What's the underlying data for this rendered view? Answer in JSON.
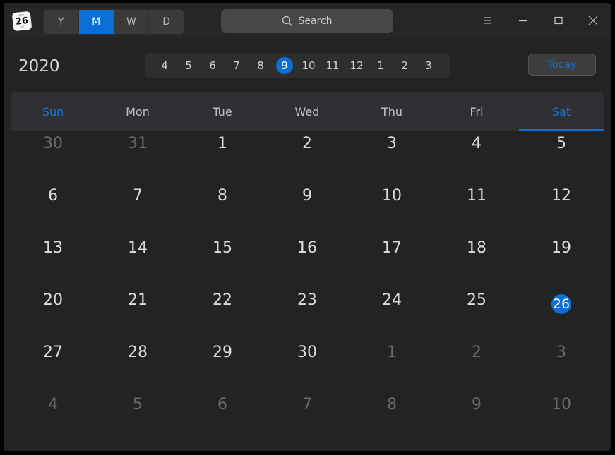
{
  "app": {
    "icon": {
      "month": "SEP",
      "day": "26",
      "weekday": "SAT"
    },
    "view_switch": [
      {
        "label": "Y",
        "active": false
      },
      {
        "label": "M",
        "active": true
      },
      {
        "label": "W",
        "active": false
      },
      {
        "label": "D",
        "active": false
      }
    ],
    "search": {
      "placeholder": "Search",
      "icon": "search-icon"
    },
    "window_controls": [
      "menu-icon",
      "minimize-icon",
      "maximize-icon",
      "close-icon"
    ]
  },
  "header": {
    "year": "2020",
    "months": [
      "4",
      "5",
      "6",
      "7",
      "8",
      "9",
      "10",
      "11",
      "12",
      "1",
      "2",
      "3"
    ],
    "active_month": "9",
    "today_label": "Today"
  },
  "calendar": {
    "weekdays": [
      "Sun",
      "Mon",
      "Tue",
      "Wed",
      "Thu",
      "Fri",
      "Sat"
    ],
    "selected_weekday": "Sat",
    "today": "26",
    "accent_color": "#0a6fd6",
    "weeks": [
      [
        {
          "d": "30",
          "o": true
        },
        {
          "d": "31",
          "o": true
        },
        {
          "d": "1"
        },
        {
          "d": "2"
        },
        {
          "d": "3"
        },
        {
          "d": "4"
        },
        {
          "d": "5"
        }
      ],
      [
        {
          "d": "6"
        },
        {
          "d": "7"
        },
        {
          "d": "8"
        },
        {
          "d": "9"
        },
        {
          "d": "10"
        },
        {
          "d": "11"
        },
        {
          "d": "12"
        }
      ],
      [
        {
          "d": "13"
        },
        {
          "d": "14"
        },
        {
          "d": "15"
        },
        {
          "d": "16"
        },
        {
          "d": "17"
        },
        {
          "d": "18"
        },
        {
          "d": "19"
        }
      ],
      [
        {
          "d": "20"
        },
        {
          "d": "21"
        },
        {
          "d": "22"
        },
        {
          "d": "23"
        },
        {
          "d": "24"
        },
        {
          "d": "25"
        },
        {
          "d": "26",
          "t": true
        }
      ],
      [
        {
          "d": "27"
        },
        {
          "d": "28"
        },
        {
          "d": "29"
        },
        {
          "d": "30"
        },
        {
          "d": "1",
          "o": true
        },
        {
          "d": "2",
          "o": true
        },
        {
          "d": "3",
          "o": true
        }
      ],
      [
        {
          "d": "4",
          "o": true
        },
        {
          "d": "5",
          "o": true
        },
        {
          "d": "6",
          "o": true
        },
        {
          "d": "7",
          "o": true
        },
        {
          "d": "8",
          "o": true
        },
        {
          "d": "9",
          "o": true
        },
        {
          "d": "10",
          "o": true
        }
      ]
    ]
  }
}
